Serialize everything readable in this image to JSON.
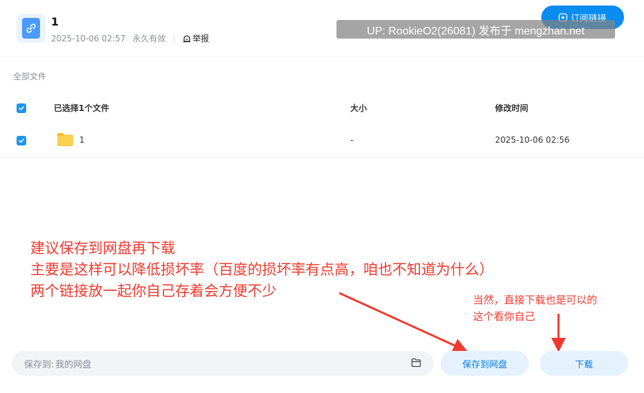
{
  "header": {
    "title": "1",
    "date": "2025-10-06 02:57",
    "validity": "永久有效",
    "report_label": "举报",
    "subscribe_label": "订阅链接",
    "watermark": "UP: RookieO2(26081) 发布于 mengzhan.net"
  },
  "breadcrumb": "全部文件",
  "table": {
    "headers": {
      "name": "已选择1个文件",
      "size": "大小",
      "modified": "修改时间"
    },
    "rows": [
      {
        "name": "1",
        "size": "-",
        "modified": "2025-10-06 02:56",
        "checked": true,
        "icon": "folder-icon"
      }
    ]
  },
  "annotations": {
    "main_lines": [
      "建议保存到网盘再下载",
      "主要是这样可以降低损坏率（百度的损坏率有点高，咱也不知道为什么）",
      "两个链接放一起你自己存着会方便不少"
    ],
    "side_lines": [
      "当然，直接下载也是可以的",
      "这个看你自己"
    ]
  },
  "footer": {
    "save_to_label": "保存到:",
    "save_to_value": "我的网盘",
    "save_button": "保存到网盘",
    "download_button": "下载"
  },
  "colors": {
    "accent": "#0a8cf0",
    "annotation": "#f03a2f",
    "checkbox": "#1f94f0"
  }
}
